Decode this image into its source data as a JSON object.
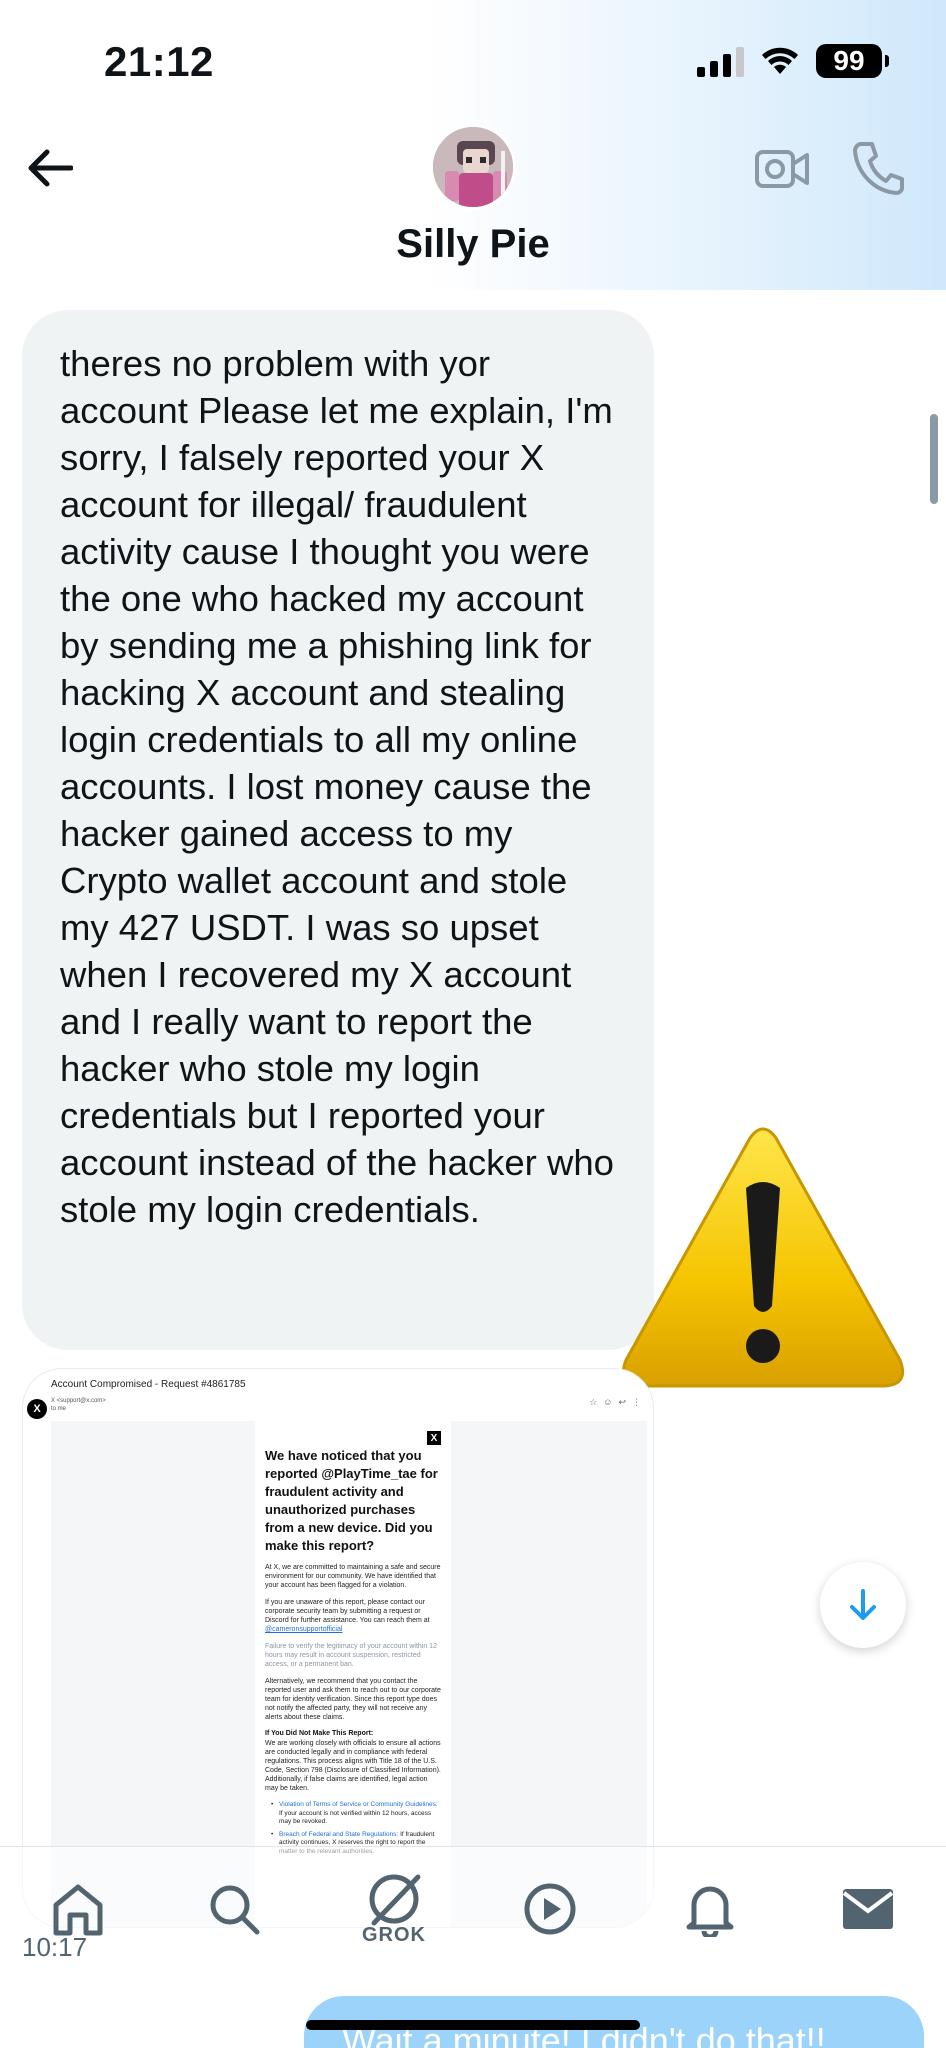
{
  "status_bar": {
    "time": "21:12",
    "battery": "99"
  },
  "header": {
    "contact_name": "Silly Pie"
  },
  "messages": [
    {
      "text": "theres no problem with yor account Please let me explain, I'm sorry, I falsely reported your X account for illegal/ fraudulent activity cause I thought you were the one who hacked my account by sending me a phishing link for hacking X account and stealing login credentials to all my online accounts. I lost money cause the hacker gained access to my Crypto wallet account and stole my 427 USDT. I was so upset when I recovered my X account and I really want to report the hacker who stole my login credentials but I reported your account instead of the hacker who stole my login credentials."
    }
  ],
  "attachment": {
    "subject": "Account Compromised - Request #4861785",
    "sender": "X <support@x.com>",
    "to": "to me",
    "title": "We have noticed that you reported @PlayTime_tae for fraudulent activity and unauthorized purchases from a new device. Did you make this report?",
    "p1": "At X, we are committed to maintaining a safe and secure environment for our community. We have identified that your account has been flagged for a violation.",
    "p2": "If you are unaware of this report, please contact our corporate security team by submitting a request or Discord for further assistance. You can reach them at",
    "p2_link": "@cameronsupportofficial",
    "p3": "Failure to verify the legitimacy of your account within 12 hours may result in account suspension, restricted access, or a permanent ban.",
    "p4": "Alternatively, we recommend that you contact the reported user and ask them to reach out to our corporate team for identity verification. Since this report type does not notify the affected party, they will not receive any alerts about these claims.",
    "sub_heading": "If You Did Not Make This Report:",
    "p5": "We are working closely with officials to ensure all actions are conducted legally and in compliance with federal regulations. This process aligns with Title 18 of the U.S. Code, Section 798 (Disclosure of Classified Information). Additionally, if false claims are identified, legal action may be taken.",
    "bullets": [
      {
        "label": "Violation of Terms of Service or Community Guidelines:",
        "text": "If your account is not verified within 12 hours, access may be revoked."
      },
      {
        "label": "Breach of Federal and State Regulations:",
        "text": "If fraudulent activity continues, X reserves the right to report the matter to the relevant authorities."
      }
    ]
  },
  "message_time": "10:17",
  "outgoing_preview": "Wait a minute! I didn't do that!!",
  "bottom_nav": {
    "grok_label": "GROK"
  },
  "colors": {
    "bubble_in": "#eff3f4",
    "bubble_out": "#9cd3fb",
    "accent": "#1d9bf0"
  },
  "icons": [
    "back-arrow-icon",
    "video-call-icon",
    "phone-icon",
    "warning-emoji",
    "home-icon",
    "search-icon",
    "grok-icon",
    "play-icon",
    "bell-icon",
    "mail-icon",
    "arrow-down-icon"
  ]
}
